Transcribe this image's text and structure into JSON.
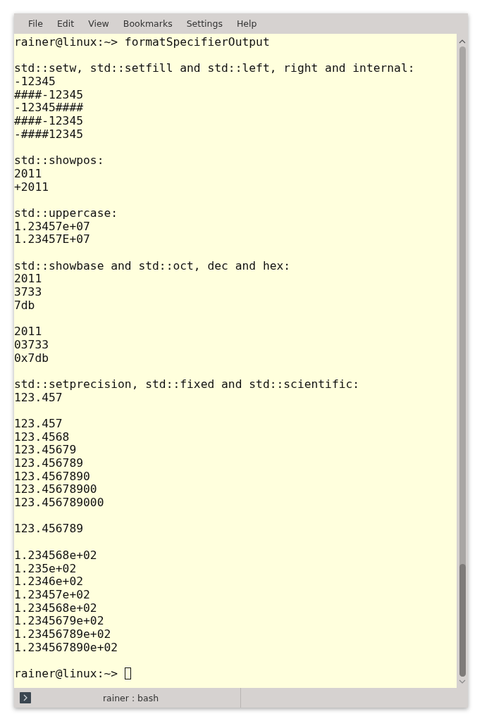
{
  "menu": [
    "File",
    "Edit",
    "View",
    "Bookmarks",
    "Settings",
    "Help"
  ],
  "blocks": [
    {
      "lines": [
        "rainer@linux:~> formatSpecifierOutput"
      ]
    },
    {
      "lines": [
        "std::setw, std::setfill and std::left, right and internal:",
        "-12345",
        "####-12345",
        "-12345####",
        "####-12345",
        "-####12345"
      ]
    },
    {
      "lines": [
        "std::showpos:",
        "2011",
        "+2011"
      ]
    },
    {
      "lines": [
        "std::uppercase:",
        "1.23457e+07",
        "1.23457E+07"
      ]
    },
    {
      "lines": [
        "std::showbase and std::oct, dec and hex:",
        "2011",
        "3733",
        "7db"
      ]
    },
    {
      "lines": [
        "2011",
        "03733",
        "0x7db"
      ]
    },
    {
      "lines": [
        "std::setprecision, std::fixed and std::scientific:",
        "123.457"
      ]
    },
    {
      "lines": [
        "123.457",
        "123.4568",
        "123.45679",
        "123.456789",
        "123.4567890",
        "123.45678900",
        "123.456789000"
      ]
    },
    {
      "lines": [
        "123.456789"
      ]
    },
    {
      "lines": [
        "1.234568e+02",
        "1.235e+02",
        "1.2346e+02",
        "1.23457e+02",
        "1.234568e+02",
        "1.2345679e+02",
        "1.23456789e+02",
        "1.234567890e+02"
      ]
    }
  ],
  "prompt": {
    "text": "rainer@linux:~> ",
    "cursor": true
  },
  "tabs": [
    {
      "label": "rainer : bash",
      "selected": true
    }
  ]
}
